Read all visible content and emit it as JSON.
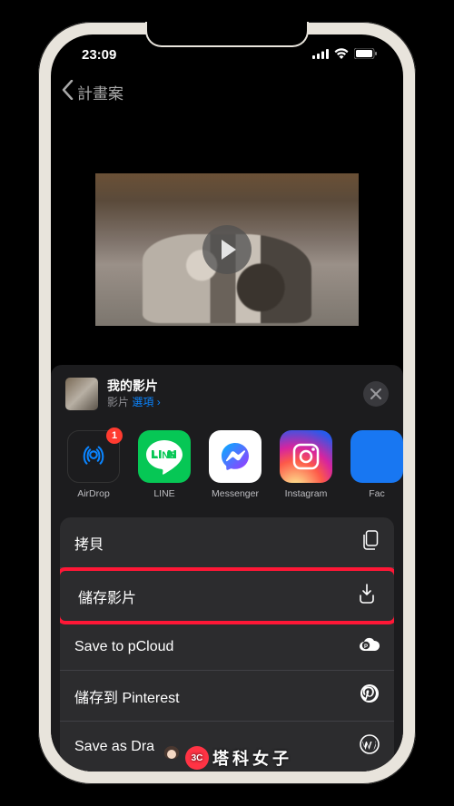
{
  "status": {
    "time": "23:09"
  },
  "nav": {
    "back_label": "計畫案"
  },
  "share": {
    "title": "我的影片",
    "subtitle_type": "影片",
    "options_label": "選項",
    "options_chevron": " ›",
    "apps": [
      {
        "label": "AirDrop",
        "badge": "1"
      },
      {
        "label": "LINE"
      },
      {
        "label": "Messenger"
      },
      {
        "label": "Instagram"
      },
      {
        "label": "Fac"
      }
    ],
    "actions": [
      {
        "label": "拷貝",
        "icon": "copy"
      },
      {
        "label": "儲存影片",
        "icon": "download",
        "highlighted": true
      },
      {
        "label": "Save to pCloud",
        "icon": "pcloud"
      },
      {
        "label": "儲存到 Pinterest",
        "icon": "pinterest"
      },
      {
        "label": "Save as Dra",
        "icon": "wordpress"
      }
    ]
  },
  "watermark": {
    "text": "塔科女子",
    "badge": "3C"
  }
}
